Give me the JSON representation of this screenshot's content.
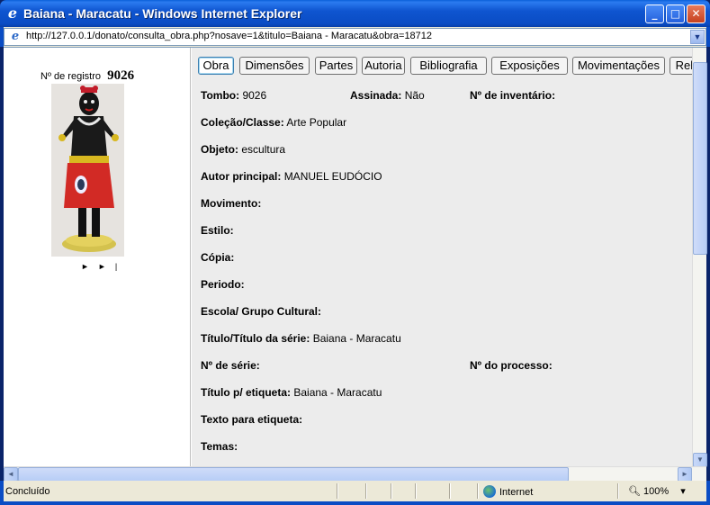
{
  "window": {
    "title": "Baiana - Maracatu - Windows Internet Explorer",
    "icon": "ie-logo-icon"
  },
  "address": {
    "url": "http://127.0.0.1/donato/consulta_obra.php?nosave=1&titulo=Baiana - Maracatu&obra=18712"
  },
  "left_panel": {
    "registro_label": "Nº de registro",
    "registro_value": "9026",
    "nav_next": "►",
    "nav_last": "►|"
  },
  "tabs": [
    {
      "label": "Obra",
      "active": true
    },
    {
      "label": "Dimensões"
    },
    {
      "label": "Partes"
    },
    {
      "label": "Autoria"
    },
    {
      "label": "Bibliografia"
    },
    {
      "label": "Exposições"
    },
    {
      "label": "Movimentações"
    },
    {
      "label": "Rela"
    }
  ],
  "fields": {
    "tombo": {
      "label": "Tombo:",
      "value": "9026"
    },
    "assinada": {
      "label": "Assinada:",
      "value": "Não"
    },
    "inventario": {
      "label": "Nº de inventário:",
      "value": ""
    },
    "colecao": {
      "label": "Coleção/Classe:",
      "value": "Arte Popular"
    },
    "objeto": {
      "label": "Objeto:",
      "value": "escultura"
    },
    "autor": {
      "label": "Autor principal:",
      "value": "MANUEL EUDÓCIO"
    },
    "movimento": {
      "label": "Movimento:",
      "value": ""
    },
    "estilo": {
      "label": "Estilo:",
      "value": ""
    },
    "copia": {
      "label": "Cópia:",
      "value": ""
    },
    "periodo": {
      "label": "Periodo:",
      "value": ""
    },
    "escola": {
      "label": "Escola/ Grupo Cultural:",
      "value": ""
    },
    "titulo_serie": {
      "label": "Título/Título da série:",
      "value": "Baiana - Maracatu"
    },
    "num_serie": {
      "label": "Nº de série:",
      "value": ""
    },
    "num_processo": {
      "label": "Nº do processo:",
      "value": ""
    },
    "titulo_etiqueta": {
      "label": "Título p/ etiqueta:",
      "value": "Baiana - Maracatu"
    },
    "texto_etiqueta": {
      "label": "Texto para etiqueta:",
      "value": ""
    },
    "temas": {
      "label": "Temas:",
      "value": ""
    }
  },
  "status": {
    "text": "Concluído",
    "zone": "Internet",
    "zoom": "100%"
  }
}
